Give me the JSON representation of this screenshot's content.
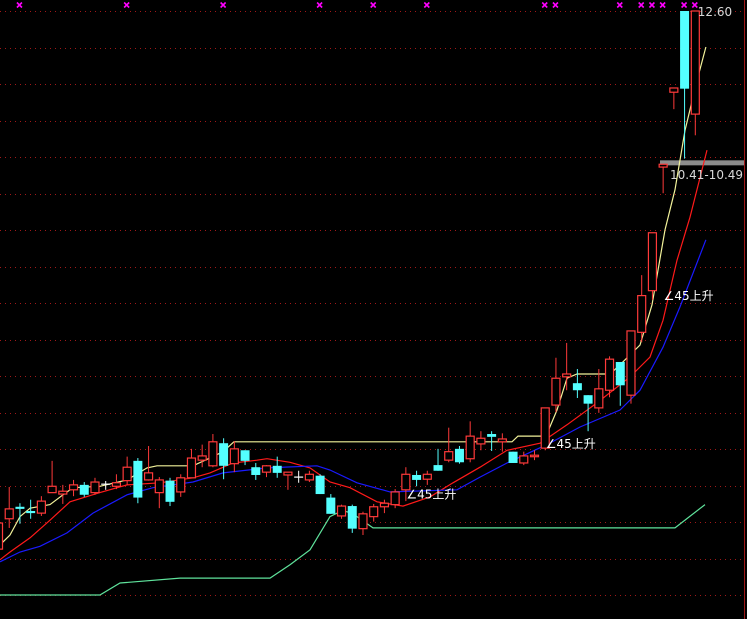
{
  "chart_data": {
    "type": "candlestick",
    "title": "",
    "ylim": [
      4.25,
      12.6
    ],
    "grid": true,
    "colors": {
      "up": "#ff3a3a",
      "down": "#54ffff",
      "doji": "#ffffff",
      "ma_fast": "#f2f29a",
      "ma_mid": "#ff1a1a",
      "ma_slow": "#1a1aff",
      "support": "#5fe39c",
      "marker": "#ff00ff",
      "grid": "#a01818",
      "highlight_bar": "#8c8c8c"
    },
    "candles": [
      [
        4.98,
        5.35,
        5.35,
        4.93
      ],
      [
        5.41,
        5.55,
        5.86,
        5.28
      ],
      [
        5.58,
        5.55,
        5.63,
        5.34
      ],
      [
        5.52,
        5.49,
        5.68,
        5.41
      ],
      [
        5.49,
        5.66,
        5.73,
        5.45
      ],
      [
        5.78,
        5.87,
        6.23,
        5.78
      ],
      [
        5.76,
        5.8,
        5.89,
        5.62
      ],
      [
        5.82,
        5.89,
        5.96,
        5.73
      ],
      [
        5.89,
        5.75,
        5.93,
        5.72
      ],
      [
        5.78,
        5.93,
        5.99,
        5.75
      ],
      [
        5.9,
        5.9,
        5.945,
        5.82
      ],
      [
        5.87,
        5.92,
        6.04,
        5.83
      ],
      [
        5.95,
        6.14,
        6.29,
        5.89
      ],
      [
        6.23,
        5.71,
        6.27,
        5.63
      ],
      [
        5.96,
        6.06,
        6.44,
        5.95
      ],
      [
        5.78,
        5.96,
        6.0,
        5.56
      ],
      [
        5.95,
        5.65,
        5.99,
        5.59
      ],
      [
        5.79,
        5.99,
        6.04,
        5.72
      ],
      [
        5.99,
        6.27,
        6.4,
        5.99
      ],
      [
        6.24,
        6.3,
        6.46,
        6.14
      ],
      [
        6.16,
        6.5,
        6.61,
        6.14
      ],
      [
        6.48,
        6.16,
        6.55,
        5.97
      ],
      [
        6.19,
        6.4,
        6.51,
        6.07
      ],
      [
        6.38,
        6.23,
        6.38,
        6.17
      ],
      [
        6.14,
        6.03,
        6.2,
        5.96
      ],
      [
        6.07,
        6.16,
        6.17,
        6.0
      ],
      [
        6.16,
        6.06,
        6.29,
        5.99
      ],
      [
        6.03,
        6.07,
        6.07,
        5.82
      ],
      [
        6.0,
        6.0,
        6.09,
        5.92
      ],
      [
        5.96,
        6.04,
        6.09,
        5.93
      ],
      [
        6.02,
        5.76,
        6.04,
        5.76
      ],
      [
        5.71,
        5.48,
        5.76,
        5.48
      ],
      [
        5.45,
        5.59,
        5.61,
        5.41
      ],
      [
        5.59,
        5.27,
        5.61,
        5.21
      ],
      [
        5.27,
        5.48,
        5.51,
        5.18
      ],
      [
        5.44,
        5.58,
        5.62,
        5.37
      ],
      [
        5.58,
        5.63,
        5.68,
        5.49
      ],
      [
        5.61,
        5.79,
        5.83,
        5.56
      ],
      [
        5.82,
        6.04,
        6.14,
        5.66
      ],
      [
        6.03,
        5.96,
        6.09,
        5.87
      ],
      [
        5.97,
        6.04,
        6.09,
        5.89
      ],
      [
        6.17,
        6.09,
        6.4,
        6.09
      ],
      [
        6.24,
        6.36,
        6.7,
        6.21
      ],
      [
        6.4,
        6.21,
        6.44,
        6.19
      ],
      [
        6.26,
        6.58,
        6.79,
        6.21
      ],
      [
        6.47,
        6.55,
        6.65,
        6.38
      ],
      [
        6.61,
        6.57,
        6.65,
        6.37
      ],
      [
        6.5,
        6.54,
        6.62,
        6.36
      ],
      [
        6.36,
        6.2,
        6.36,
        6.2
      ],
      [
        6.2,
        6.3,
        6.36,
        6.17
      ],
      [
        6.29,
        6.31,
        6.38,
        6.24
      ],
      [
        6.41,
        6.98,
        6.98,
        6.38
      ],
      [
        7.02,
        7.4,
        7.69,
        6.92
      ],
      [
        7.42,
        7.46,
        7.9,
        7.23
      ],
      [
        7.33,
        7.23,
        7.53,
        7.12
      ],
      [
        7.16,
        7.04,
        7.16,
        6.65
      ],
      [
        6.98,
        7.25,
        7.53,
        6.91
      ],
      [
        7.23,
        7.67,
        7.71,
        7.13
      ],
      [
        7.63,
        7.3,
        7.63,
        7.01
      ],
      [
        7.16,
        8.07,
        8.07,
        7.04
      ],
      [
        8.05,
        8.57,
        8.86,
        7.91
      ],
      [
        8.64,
        9.46,
        9.46,
        8.51
      ],
      [
        10.39,
        10.43,
        10.43,
        10.02
      ],
      [
        11.45,
        11.51,
        11.51,
        11.21
      ],
      [
        12.6,
        11.5,
        12.6,
        10.51
      ],
      [
        11.14,
        12.6,
        12.6,
        10.84
      ]
    ],
    "candle_fields": [
      "open",
      "close",
      "high",
      "low"
    ],
    "lines": [
      {
        "name": "ma-fast-yellow",
        "color_key": "ma_fast",
        "points": [
          [
            0.19,
            5.04
          ],
          [
            1.12,
            5.18
          ],
          [
            2.05,
            5.44
          ],
          [
            2.99,
            5.56
          ],
          [
            4.85,
            5.61
          ],
          [
            6.06,
            5.75
          ],
          [
            7.0,
            5.85
          ],
          [
            9.51,
            5.87
          ],
          [
            12.03,
            5.96
          ],
          [
            13.9,
            6.13
          ],
          [
            14.83,
            6.16
          ],
          [
            18.19,
            6.16
          ],
          [
            20.06,
            6.29
          ],
          [
            20.99,
            6.36
          ],
          [
            22.01,
            6.5
          ],
          [
            47.95,
            6.5
          ],
          [
            48.51,
            6.58
          ],
          [
            51.12,
            6.58
          ],
          [
            52.15,
            6.95
          ],
          [
            53.08,
            7.4
          ],
          [
            54.01,
            7.46
          ],
          [
            57.09,
            7.46
          ],
          [
            58.02,
            7.59
          ],
          [
            59.89,
            7.87
          ],
          [
            61.01,
            8.44
          ],
          [
            62.22,
            9.5
          ],
          [
            63.15,
            10.07
          ],
          [
            64.09,
            10.91
          ],
          [
            65.21,
            11.62
          ],
          [
            66.04,
            12.09
          ]
        ]
      },
      {
        "name": "ma-mid-red",
        "color_key": "ma_mid",
        "points": [
          [
            0.19,
            4.83
          ],
          [
            1.12,
            4.94
          ],
          [
            2.99,
            5.14
          ],
          [
            4.85,
            5.39
          ],
          [
            6.72,
            5.65
          ],
          [
            9.51,
            5.78
          ],
          [
            12.03,
            5.89
          ],
          [
            15.11,
            5.92
          ],
          [
            18.19,
            5.99
          ],
          [
            19.78,
            6.06
          ],
          [
            21.92,
            6.2
          ],
          [
            24.16,
            6.24
          ],
          [
            25.09,
            6.26
          ],
          [
            27.24,
            6.21
          ],
          [
            29.1,
            6.13
          ],
          [
            30.97,
            5.93
          ],
          [
            32.84,
            5.85
          ],
          [
            35.35,
            5.65
          ],
          [
            37.78,
            5.59
          ],
          [
            40.3,
            5.72
          ],
          [
            42.44,
            5.92
          ],
          [
            44.96,
            6.14
          ],
          [
            47.48,
            6.38
          ],
          [
            50.56,
            6.48
          ],
          [
            53.08,
            6.74
          ],
          [
            55.88,
            7.05
          ],
          [
            58.96,
            7.42
          ],
          [
            60.82,
            7.7
          ],
          [
            62.03,
            8.22
          ],
          [
            63.34,
            9.07
          ],
          [
            64.55,
            9.68
          ],
          [
            66.14,
            10.63
          ]
        ]
      },
      {
        "name": "ma-slow-blue",
        "color_key": "ma_slow",
        "points": [
          [
            0.19,
            4.8
          ],
          [
            2.05,
            4.94
          ],
          [
            3.92,
            5.02
          ],
          [
            6.44,
            5.21
          ],
          [
            8.86,
            5.49
          ],
          [
            12.03,
            5.75
          ],
          [
            14.46,
            5.85
          ],
          [
            18.19,
            5.93
          ],
          [
            20.99,
            6.06
          ],
          [
            25.09,
            6.13
          ],
          [
            29.76,
            6.16
          ],
          [
            30.97,
            6.1
          ],
          [
            33.49,
            5.92
          ],
          [
            36.57,
            5.79
          ],
          [
            42.82,
            5.82
          ],
          [
            44.96,
            6.0
          ],
          [
            47.48,
            6.2
          ],
          [
            51.21,
            6.46
          ],
          [
            54.29,
            6.71
          ],
          [
            58.02,
            6.95
          ],
          [
            59.89,
            7.23
          ],
          [
            62.03,
            7.84
          ],
          [
            63.62,
            8.41
          ],
          [
            66.04,
            9.36
          ]
        ]
      },
      {
        "name": "support-line-green",
        "color_key": "support",
        "points": [
          [
            0.19,
            4.33
          ],
          [
            9.51,
            4.33
          ],
          [
            11.38,
            4.5
          ],
          [
            16.98,
            4.57
          ],
          [
            25.37,
            4.57
          ],
          [
            27.24,
            4.76
          ],
          [
            29.1,
            4.97
          ],
          [
            30.97,
            5.44
          ],
          [
            31.9,
            5.51
          ],
          [
            32.56,
            5.51
          ],
          [
            33.49,
            5.44
          ],
          [
            34.98,
            5.28
          ],
          [
            63.15,
            5.28
          ],
          [
            65.95,
            5.61
          ]
        ]
      }
    ],
    "signal_markers": [
      2,
      12,
      21,
      30,
      35,
      40,
      51,
      52,
      58,
      60,
      61,
      62,
      64,
      65
    ],
    "annotations": [
      {
        "text": "∠45上升",
        "index": 38,
        "price": 5.77
      },
      {
        "text": "∠45上升",
        "index": 51,
        "price": 6.48
      },
      {
        "text": "∠45上升",
        "index": 62,
        "price": 8.58
      }
    ],
    "max_label": {
      "text": "12.60",
      "index": 65,
      "price": 12.6
    },
    "range_label": {
      "text": "10.41-10.49",
      "price_low": 10.41,
      "price_high": 10.49
    }
  }
}
